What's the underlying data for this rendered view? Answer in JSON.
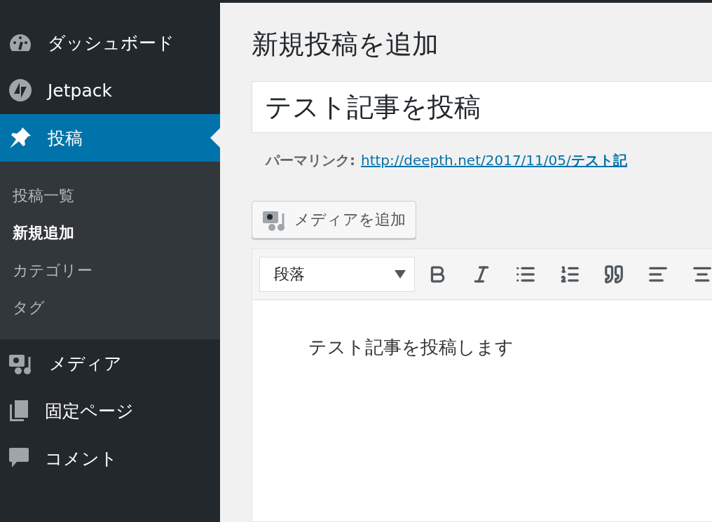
{
  "sidebar": {
    "items": [
      {
        "kind": "dashboard",
        "label": "ダッシュボード",
        "selected": false
      },
      {
        "kind": "jetpack",
        "label": "Jetpack",
        "selected": false
      },
      {
        "kind": "pin",
        "label": "投稿",
        "selected": true,
        "children": [
          {
            "label": "投稿一覧",
            "selected": false
          },
          {
            "label": "新規追加",
            "selected": true
          },
          {
            "label": "カテゴリー",
            "selected": false
          },
          {
            "label": "タグ",
            "selected": false
          }
        ]
      },
      {
        "kind": "media",
        "label": "メディア",
        "selected": false
      },
      {
        "kind": "pages",
        "label": "固定ページ",
        "selected": false
      },
      {
        "kind": "comment",
        "label": "コメント",
        "selected": false
      }
    ]
  },
  "page_title": "新規投稿を追加",
  "post_title": {
    "value": "テスト記事を投稿"
  },
  "permalink": {
    "label": "パーマリンク:",
    "url": "http://deepth.net/2017/11/05/",
    "slug": "テスト記"
  },
  "add_media_button": "メディアを追加",
  "editor": {
    "format_select": "段落",
    "tools": [
      {
        "kind": "bold"
      },
      {
        "kind": "italic"
      },
      {
        "kind": "bullet-list"
      },
      {
        "kind": "numbered-list"
      },
      {
        "kind": "quote"
      },
      {
        "kind": "align-left"
      },
      {
        "kind": "align-center"
      }
    ],
    "content": "テスト記事を投稿します"
  }
}
